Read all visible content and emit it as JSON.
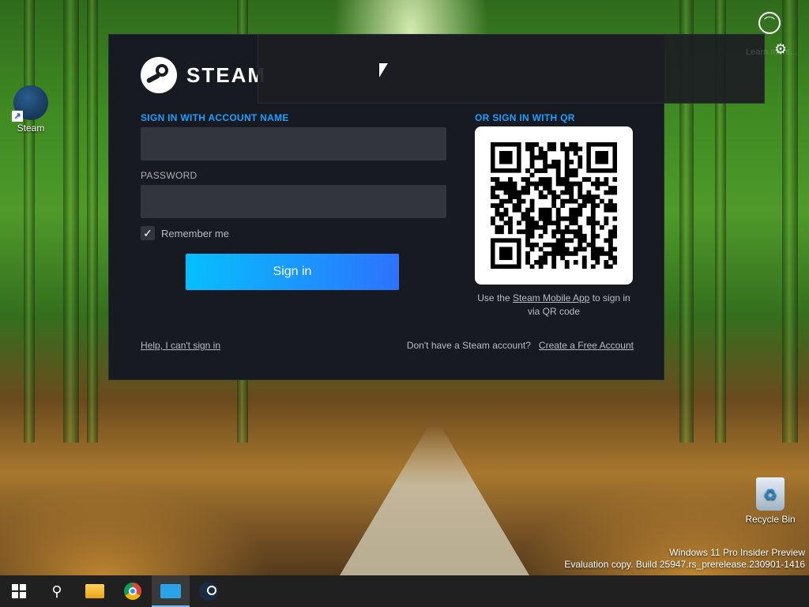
{
  "desktop": {
    "icons": [
      {
        "label": "Steam"
      },
      {
        "label": "Recycle Bin"
      }
    ],
    "watermark": {
      "line1": "Windows 11 Pro Insider Preview",
      "line2": "Evaluation copy. Build 25947.rs_prerelease.230901-1416"
    }
  },
  "steam_login": {
    "logo_text": "STEAM",
    "account_label": "SIGN IN WITH ACCOUNT NAME",
    "account_value": "",
    "password_label": "PASSWORD",
    "password_value": "",
    "remember_label": "Remember me",
    "remember_checked": true,
    "checkmark": "✓",
    "signin_label": "Sign in",
    "qr_label": "OR SIGN IN WITH QR",
    "qr_caption_prefix": "Use the ",
    "qr_caption_link": "Steam Mobile App",
    "qr_caption_suffix": " to sign in via QR code",
    "help_link": "Help, I can't sign in",
    "no_account_text": "Don't have a Steam account?",
    "create_account_link": "Create a Free Account",
    "accent_color": "#1a9fff"
  },
  "overlay": {
    "faint_text": "Learn more...",
    "user_icon": "user-circle-icon",
    "gear_icon": "gear-icon"
  },
  "taskbar": {
    "items": [
      {
        "name": "start",
        "icon": "windows-logo-icon"
      },
      {
        "name": "search",
        "icon": "search-icon"
      },
      {
        "name": "file-explorer",
        "icon": "folder-icon"
      },
      {
        "name": "chrome",
        "icon": "chrome-icon"
      },
      {
        "name": "active-app",
        "icon": "keyboard-app-icon",
        "active": true
      },
      {
        "name": "steam",
        "icon": "steam-icon"
      }
    ]
  }
}
